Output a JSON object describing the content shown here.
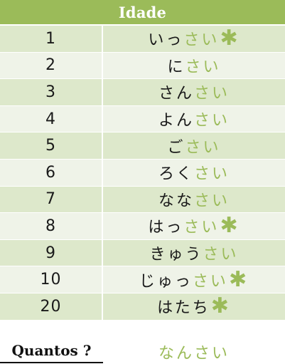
{
  "header": {
    "title": "Idade"
  },
  "colors": {
    "accent": "#9bbb59",
    "row_light": "#eff3e8",
    "row_dark": "#dde8cb",
    "text": "#1a1a1a"
  },
  "rows": [
    {
      "number": "1",
      "black": "いっ",
      "green": "さい",
      "asterisk": true
    },
    {
      "number": "2",
      "black": "に",
      "green": "さい",
      "asterisk": false
    },
    {
      "number": "3",
      "black": "さん",
      "green": "さい",
      "asterisk": false
    },
    {
      "number": "4",
      "black": "よん",
      "green": "さい",
      "asterisk": false
    },
    {
      "number": "5",
      "black": "ご",
      "green": "さい",
      "asterisk": false
    },
    {
      "number": "6",
      "black": "ろく",
      "green": "さい",
      "asterisk": false
    },
    {
      "number": "7",
      "black": "なな",
      "green": "さい",
      "asterisk": false
    },
    {
      "number": "8",
      "black": "はっ",
      "green": "さい",
      "asterisk": true
    },
    {
      "number": "9",
      "black": "きゅう",
      "green": "さい",
      "asterisk": false
    },
    {
      "number": "10",
      "black": "じゅっ",
      "green": "さい",
      "asterisk": true
    },
    {
      "number": "20",
      "black": "はたち",
      "green": "",
      "asterisk": true
    }
  ],
  "asterisk_symbol": "✱",
  "footer": {
    "label": "Quantos ?",
    "answer": "なんさい"
  }
}
